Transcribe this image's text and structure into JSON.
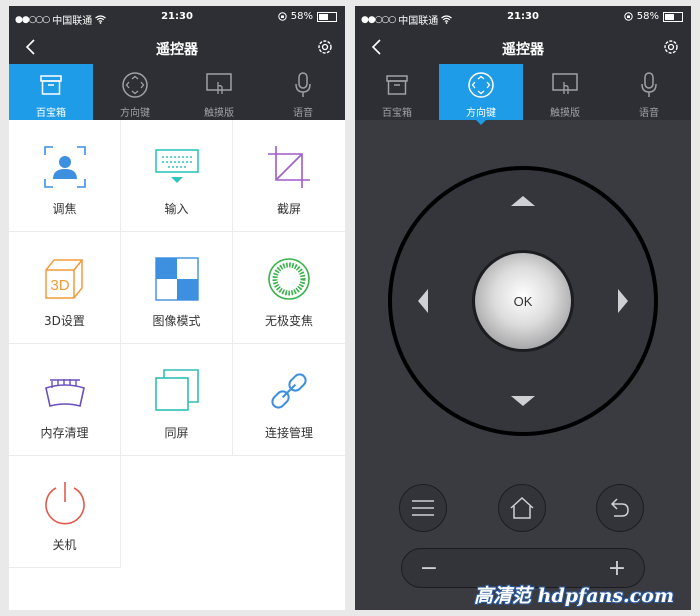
{
  "statusbar": {
    "carrier": "中国联通",
    "time": "21:30",
    "battery": "58%",
    "battery_level": 0.58
  },
  "navbar": {
    "title": "遥控器"
  },
  "tabs": [
    {
      "label": "百宝箱",
      "icon": "toolbox-icon"
    },
    {
      "label": "方向键",
      "icon": "direction-pad-icon"
    },
    {
      "label": "触摸版",
      "icon": "touchpad-icon"
    },
    {
      "label": "语音",
      "icon": "microphone-icon"
    }
  ],
  "left_screen": {
    "active_tab": "百宝箱"
  },
  "right_screen": {
    "active_tab": "方向键"
  },
  "toolbox": {
    "items": [
      {
        "label": "调焦",
        "icon": "focus-icon"
      },
      {
        "label": "输入",
        "icon": "keyboard-icon"
      },
      {
        "label": "截屏",
        "icon": "screenshot-icon"
      },
      {
        "label": "3D设置",
        "icon": "3d-cube-icon"
      },
      {
        "label": "图像模式",
        "icon": "image-mode-icon"
      },
      {
        "label": "无极变焦",
        "icon": "zoom-dial-icon"
      },
      {
        "label": "内存清理",
        "icon": "memory-clean-icon"
      },
      {
        "label": "同屏",
        "icon": "mirror-screen-icon"
      },
      {
        "label": "连接管理",
        "icon": "link-icon"
      },
      {
        "label": "关机",
        "icon": "power-icon"
      }
    ]
  },
  "dpad": {
    "ok_label": "OK"
  },
  "bottom_controls": [
    "menu-icon",
    "home-icon",
    "back-icon"
  ],
  "volume": {
    "minus": "−",
    "plus": "+"
  },
  "watermark": "高清范 hdpfans.com",
  "colors": {
    "accent": "#1f9ce8",
    "dark": "#2e2f35",
    "panel": "#3a3b41"
  }
}
